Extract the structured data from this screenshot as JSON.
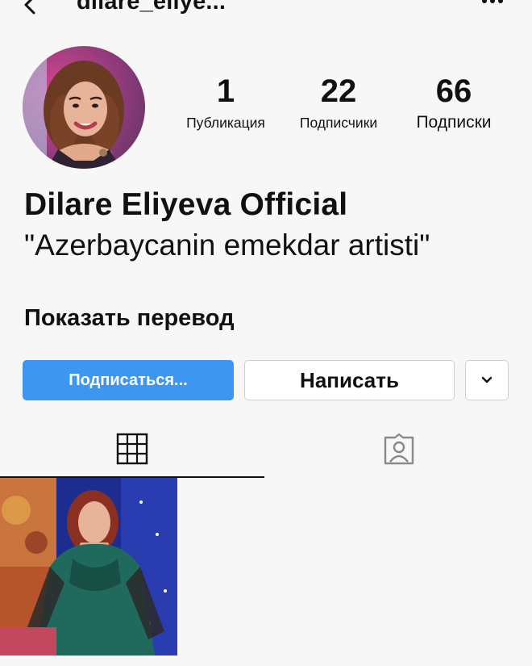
{
  "header": {
    "username": "dilare_eliye...",
    "back_icon": "chevron-left-icon",
    "more_icon": "more-horizontal-icon"
  },
  "profile": {
    "stats": [
      {
        "count": "1",
        "label": "Публикация"
      },
      {
        "count": "22",
        "label": "Подписчики"
      },
      {
        "count": "66",
        "label": "Подписки"
      }
    ],
    "display_name": "Dilare Eliyeva Official",
    "bio": "\"Azerbaycanin emekdar artisti\"",
    "translate_link": "Показать перевод"
  },
  "actions": {
    "follow_label": "Подписаться...",
    "message_label": "Написать",
    "more_icon": "chevron-down-icon"
  },
  "tabs": [
    {
      "icon": "grid-icon",
      "active": true
    },
    {
      "icon": "tagged-person-icon",
      "active": false
    }
  ],
  "colors": {
    "accent": "#3d97f0",
    "background": "#f7f7f7",
    "text": "#111111"
  }
}
